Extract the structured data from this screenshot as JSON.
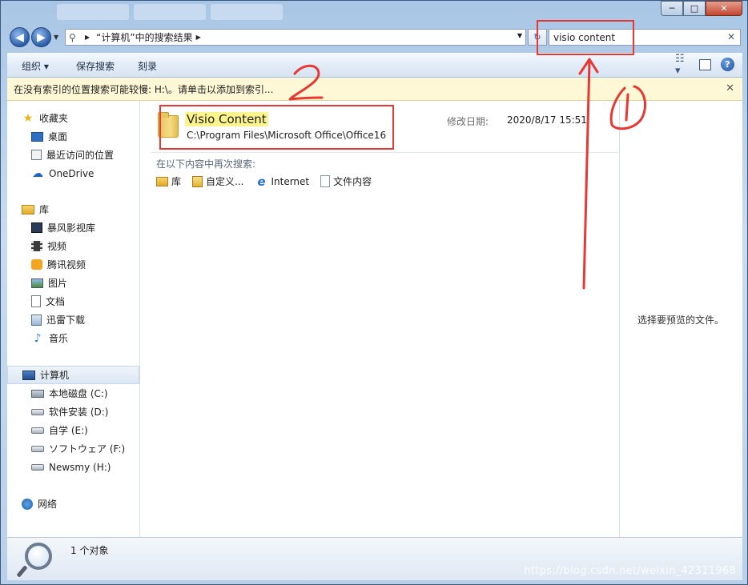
{
  "window": {
    "controls": {
      "minimize": "─",
      "maximize": "□",
      "close": "✕"
    }
  },
  "address_bar": {
    "back_icon": "arrow-left-icon",
    "forward_icon": "arrow-right-icon",
    "breadcrumb": "“计算机”中的搜索结果",
    "search_query": "visio content"
  },
  "toolbar": {
    "organize": "组织 ▾",
    "save_search": "保存搜索",
    "burn": "刻录"
  },
  "infobar": {
    "message": "在没有索引的位置搜索可能较慢: H:\\。请单击以添加到索引..."
  },
  "nav": {
    "favorites": {
      "label": "收藏夹",
      "items": [
        {
          "label": "桌面",
          "icon": "desktop-icon"
        },
        {
          "label": "最近访问的位置",
          "icon": "recent-places-icon"
        },
        {
          "label": "OneDrive",
          "icon": "onedrive-icon"
        }
      ]
    },
    "libraries": {
      "label": "库",
      "items": [
        {
          "label": "暴风影视库",
          "icon": "video-library-icon"
        },
        {
          "label": "视频",
          "icon": "videos-icon"
        },
        {
          "label": "腾讯视频",
          "icon": "tencent-video-icon"
        },
        {
          "label": "图片",
          "icon": "pictures-icon"
        },
        {
          "label": "文档",
          "icon": "documents-icon"
        },
        {
          "label": "迅雷下载",
          "icon": "downloads-icon"
        },
        {
          "label": "音乐",
          "icon": "music-icon"
        }
      ]
    },
    "computer": {
      "label": "计算机",
      "items": [
        {
          "label": "本地磁盘 (C:)",
          "icon": "system-drive-icon"
        },
        {
          "label": "软件安装 (D:)",
          "icon": "drive-icon"
        },
        {
          "label": "自学 (E:)",
          "icon": "drive-icon"
        },
        {
          "label": "ソフトウェア (F:)",
          "icon": "drive-icon"
        },
        {
          "label": "Newsmy (H:)",
          "icon": "drive-icon"
        }
      ]
    },
    "network": {
      "label": "网络"
    }
  },
  "results": [
    {
      "name": "Visio Content",
      "path": "C:\\Program Files\\Microsoft Office\\Office16",
      "date_label": "修改日期:",
      "date": "2020/8/17 15:51"
    }
  ],
  "search_again": {
    "label": "在以下内容中再次搜索:",
    "options": [
      "库",
      "自定义...",
      "Internet",
      "文件内容"
    ]
  },
  "preview": {
    "message": "选择要预览的文件。"
  },
  "status": {
    "count": "1 个对象"
  },
  "watermark": "https://blog.csdn.net/weixin_42311968",
  "annotations": {
    "marker_1": "①",
    "marker_2": "②"
  },
  "colors": {
    "annotation_red": "#e53935",
    "highlight_yellow": "#fdf48d",
    "infobar_bg": "#fff8d6"
  }
}
